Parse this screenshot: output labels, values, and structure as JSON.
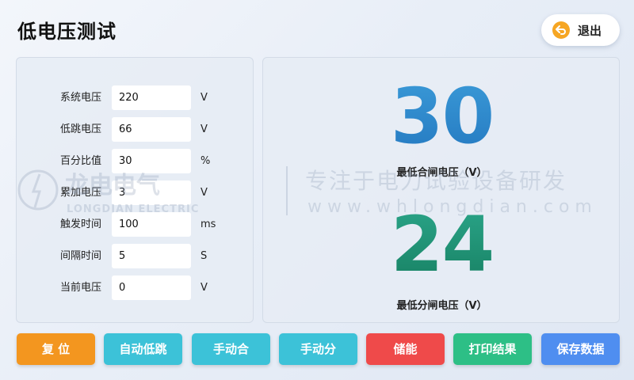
{
  "header": {
    "title": "低电压测试",
    "exit_label": "退出"
  },
  "params": [
    {
      "label": "系统电压",
      "value": "220",
      "unit": "V"
    },
    {
      "label": "低跳电压",
      "value": "66",
      "unit": "V"
    },
    {
      "label": "百分比值",
      "value": "30",
      "unit": "%"
    },
    {
      "label": "累加电压",
      "value": "3",
      "unit": "V"
    },
    {
      "label": "触发时间",
      "value": "100",
      "unit": "ms"
    },
    {
      "label": "间隔时间",
      "value": "5",
      "unit": "S"
    },
    {
      "label": "当前电压",
      "value": "0",
      "unit": "V"
    }
  ],
  "results": {
    "close_value": "30",
    "close_caption": "最低合闸电压（V）",
    "open_value": "24",
    "open_caption": "最低分闸电压（V）"
  },
  "watermark": {
    "brand": "龙电电气",
    "brand_en": "LONGDIAN ELECTRIC",
    "slogan": "专注于电力试验设备研发",
    "url": "www.whlongdian.com"
  },
  "buttons": [
    {
      "label": "复 位",
      "color": "#f3961f"
    },
    {
      "label": "自动低跳",
      "color": "#3cc2d8"
    },
    {
      "label": "手动合",
      "color": "#3cc2d8"
    },
    {
      "label": "手动分",
      "color": "#3cc2d8"
    },
    {
      "label": "储能",
      "color": "#ef4a4a"
    },
    {
      "label": "打印结果",
      "color": "#2dbf86"
    },
    {
      "label": "保存数据",
      "color": "#4f8ef0"
    }
  ],
  "colors": {
    "close_number": "#2a86cc",
    "open_number": "#1f9276",
    "exit_icon": "#f6a623"
  }
}
